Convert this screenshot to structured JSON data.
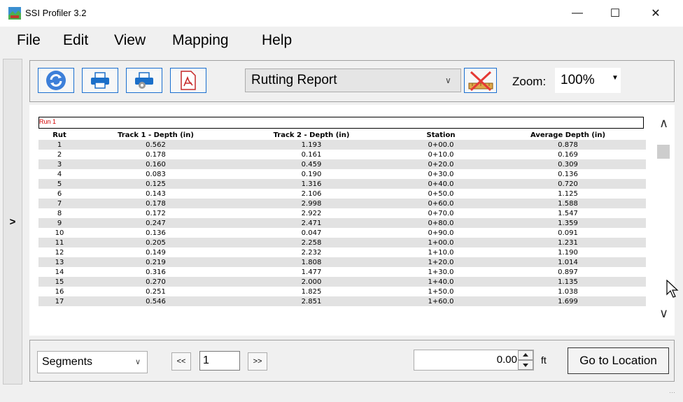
{
  "window": {
    "title": "SSI Profiler 3.2",
    "minimize_glyph": "—",
    "maximize_glyph": "☐",
    "close_glyph": "✕"
  },
  "menu": {
    "items": [
      {
        "label": "File"
      },
      {
        "label": "Edit"
      },
      {
        "label": "View"
      },
      {
        "label": "Mapping"
      },
      {
        "label": "Help"
      }
    ]
  },
  "sidebar": {
    "expand_glyph": ">"
  },
  "toolbar": {
    "buttons": [
      {
        "icon": "refresh-icon"
      },
      {
        "icon": "print-icon"
      },
      {
        "icon": "print-settings-icon"
      },
      {
        "icon": "pdf-icon"
      }
    ],
    "report_selected": "Rutting Report",
    "report_tool_icon": "ruler-edit-icon",
    "zoom_label": "Zoom:",
    "zoom_value": "100%"
  },
  "report": {
    "run_label": "Run 1",
    "columns": [
      "Rut",
      "Track 1 - Depth (in)",
      "Track 2 - Depth (in)",
      "Station",
      "Average Depth (in)"
    ],
    "rows": [
      [
        "1",
        "0.562",
        "1.193",
        "0+00.0",
        "0.878"
      ],
      [
        "2",
        "0.178",
        "0.161",
        "0+10.0",
        "0.169"
      ],
      [
        "3",
        "0.160",
        "0.459",
        "0+20.0",
        "0.309"
      ],
      [
        "4",
        "0.083",
        "0.190",
        "0+30.0",
        "0.136"
      ],
      [
        "5",
        "0.125",
        "1.316",
        "0+40.0",
        "0.720"
      ],
      [
        "6",
        "0.143",
        "2.106",
        "0+50.0",
        "1.125"
      ],
      [
        "7",
        "0.178",
        "2.998",
        "0+60.0",
        "1.588"
      ],
      [
        "8",
        "0.172",
        "2.922",
        "0+70.0",
        "1.547"
      ],
      [
        "9",
        "0.247",
        "2.471",
        "0+80.0",
        "1.359"
      ],
      [
        "10",
        "0.136",
        "0.047",
        "0+90.0",
        "0.091"
      ],
      [
        "11",
        "0.205",
        "2.258",
        "1+00.0",
        "1.231"
      ],
      [
        "12",
        "0.149",
        "2.232",
        "1+10.0",
        "1.190"
      ],
      [
        "13",
        "0.219",
        "1.808",
        "1+20.0",
        "1.014"
      ],
      [
        "14",
        "0.316",
        "1.477",
        "1+30.0",
        "0.897"
      ],
      [
        "15",
        "0.270",
        "2.000",
        "1+40.0",
        "1.135"
      ],
      [
        "16",
        "0.251",
        "1.825",
        "1+50.0",
        "1.038"
      ],
      [
        "17",
        "0.546",
        "2.851",
        "1+60.0",
        "1.699"
      ]
    ]
  },
  "bottom": {
    "segments_selected": "Segments",
    "prev_label": "<<",
    "page_value": "1",
    "next_label": ">>",
    "location_value": "0.00",
    "location_unit": "ft",
    "goto_label": "Go to Location"
  }
}
